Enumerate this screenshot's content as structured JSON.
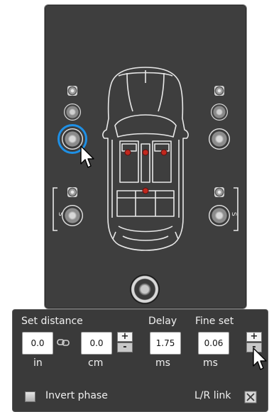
{
  "car_view": {
    "speakers": [
      {
        "name": "left-front-tweeter",
        "type": "tweeter"
      },
      {
        "name": "left-front-mid",
        "type": "mid"
      },
      {
        "name": "left-front-woofer",
        "type": "woofer",
        "selected": true
      },
      {
        "name": "left-rear-tweeter",
        "type": "tweeter"
      },
      {
        "name": "left-rear-woofer",
        "type": "woofer"
      },
      {
        "name": "right-front-tweeter",
        "type": "tweeter"
      },
      {
        "name": "right-front-mid",
        "type": "mid"
      },
      {
        "name": "right-front-woofer",
        "type": "woofer"
      },
      {
        "name": "right-rear-tweeter",
        "type": "tweeter"
      },
      {
        "name": "right-rear-woofer",
        "type": "woofer"
      },
      {
        "name": "subwoofer",
        "type": "subwoofer"
      }
    ],
    "rear_bracket_label": "S",
    "accent_color": "#1e90e6",
    "panel_color": "#3e3e3e",
    "listener_dot_color": "#c0281e"
  },
  "controls": {
    "set_distance_label": "Set distance",
    "delay_label": "Delay",
    "fine_set_label": "Fine set",
    "distance_in_value": "0.0",
    "distance_cm_value": "0.0",
    "delay_value": "1.75",
    "fine_set_value": "0.06",
    "unit_in": "in",
    "unit_cm": "cm",
    "unit_ms_delay": "ms",
    "unit_ms_fine": "ms",
    "plus_label": "+",
    "minus_label": "-",
    "invert_phase_label": "Invert phase",
    "invert_phase_checked": false,
    "lr_link_label": "L/R link",
    "lr_link_enabled": false
  }
}
